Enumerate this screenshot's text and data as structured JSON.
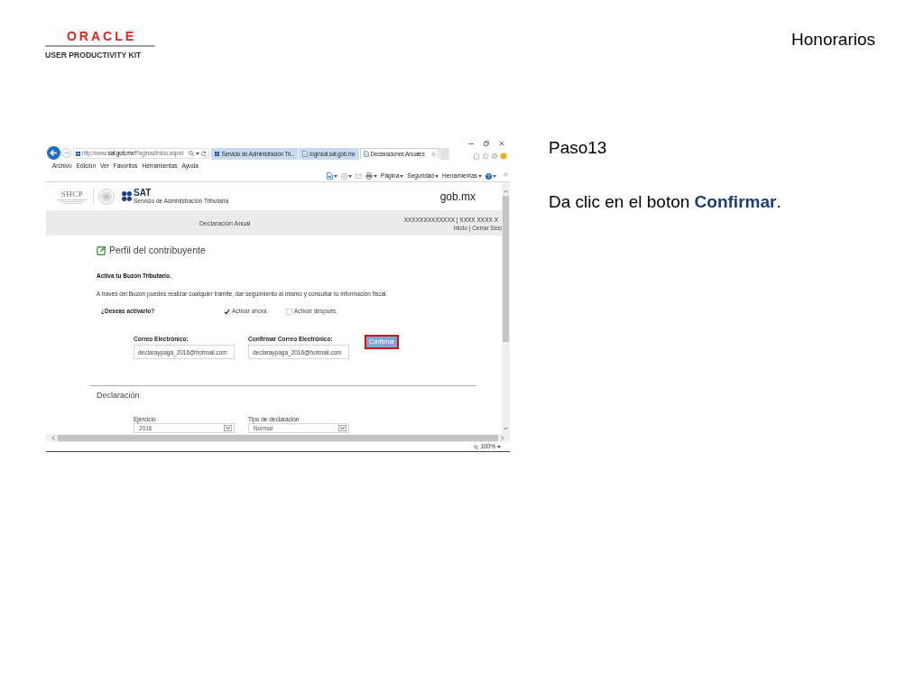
{
  "header": {
    "logo": {
      "wordmark": "ORACLE",
      "tagline": "USER PRODUCTIVITY KIT"
    },
    "title": "Honorarios"
  },
  "screenshot": {
    "browser": {
      "address": "http://www.**sat.gob.mx**/Paginas/Inicio.aspx#",
      "tabs": [
        {
          "label": "Servicio de Administración Tri...",
          "selected": false
        },
        {
          "label": "loginsat.sat.gob.mx",
          "selected": false
        },
        {
          "label": "Declaraciones Anuales",
          "selected": true
        }
      ],
      "menu": [
        "Archivo",
        "Edición",
        "Ver",
        "Favoritos",
        "Herramientas",
        "Ayuda"
      ],
      "commands": [
        "Página",
        "Seguridad",
        "Herramientas"
      ],
      "zoom": "100%"
    },
    "site": {
      "header": {
        "shcp": "SHCP",
        "sat": "SAT",
        "sat_subtitle": "Servicio de Administración Tributaria",
        "gob": "gob.mx"
      },
      "bar": {
        "title": "Declaración Anual",
        "user": "XXXXXXXXXXXXX | XXXX XXXX X",
        "links": "Inicio | Cerrar Sesi"
      },
      "profile": {
        "title": "Perfil del contribuyente",
        "subtitle": "Activa tu Buzón Tributario.",
        "description": "A través del Buzón puedes realizar cualquier trámite, dar seguimiento al mismo y consultar tu información fiscal.",
        "question": "¿Deseas activarlo?",
        "options": [
          {
            "label": "Activar ahora.",
            "checked": true
          },
          {
            "label": "Activar después.",
            "checked": false
          }
        ],
        "fields": [
          {
            "label": "Correo Electrónico:",
            "value": "declaraypaga_2016@hotmail.com"
          },
          {
            "label": "Confirmar Correo Electrónico:",
            "value": "declaraypaga_2016@hotmail.com"
          }
        ],
        "button": {
          "label": "Confirmar",
          "highlighted": true
        }
      },
      "declaration": {
        "title": "Declaración",
        "fields": [
          {
            "label": "Ejercicio",
            "value": "2016"
          },
          {
            "label": "Tipo de declaración",
            "value": "Normal"
          }
        ]
      }
    }
  },
  "instructions": {
    "step": "Paso13",
    "text": "Da clic en el boton **Confirmar**."
  }
}
